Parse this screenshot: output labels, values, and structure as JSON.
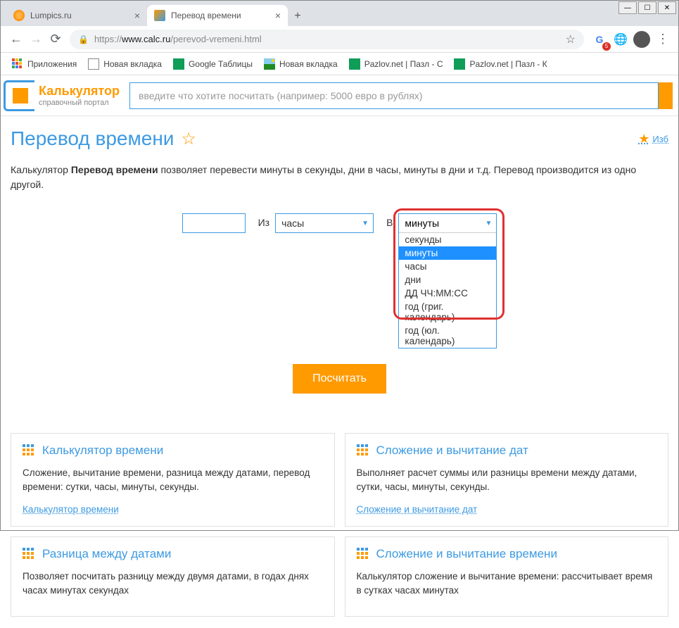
{
  "window": {
    "min": "—",
    "max": "☐",
    "close": "✕"
  },
  "tabs": [
    {
      "title": "Lumpics.ru",
      "favicon": "orange"
    },
    {
      "title": "Перевод времени",
      "favicon": "calc",
      "active": true
    }
  ],
  "address": {
    "url_proto": "https://",
    "url_host": "www.calc.ru",
    "url_path": "/perevod-vremeni.html",
    "gt_badge": "5"
  },
  "bookmarks": [
    {
      "label": "Приложения",
      "icon": "apps"
    },
    {
      "label": "Новая вкладка",
      "icon": "doc"
    },
    {
      "label": "Google Таблицы",
      "icon": "sheets"
    },
    {
      "label": "Новая вкладка",
      "icon": "img"
    },
    {
      "label": "Pazlov.net | Пазл - С",
      "icon": "puzzle"
    },
    {
      "label": "Pazlov.net | Пазл - К",
      "icon": "puzzle"
    }
  ],
  "site": {
    "brand": "Калькулятор",
    "subtitle": "справочный портал",
    "search_placeholder": "введите что хотите посчитать (например: 5000 евро в рублях)"
  },
  "page": {
    "title": "Перевод времени",
    "fav_link": "Изб",
    "desc_prefix": "Калькулятор ",
    "desc_bold": "Перевод времени",
    "desc_suffix": " позволяет перевести минуты в секунды, дни в часы, минуты в дни и т.д. Перевод производится из одно другой."
  },
  "converter": {
    "from_label": "Из",
    "from_value": "часы",
    "to_label": "В",
    "to_value": "минуты",
    "options": [
      "секунды",
      "минуты",
      "часы",
      "дни",
      "ДД ЧЧ:ММ:СС",
      "год (григ. календарь)",
      "год (юл. календарь)"
    ],
    "highlighted_index": 1,
    "button": "Посчитать"
  },
  "cards": {
    "left": [
      {
        "title": "Калькулятор времени",
        "desc": "Сложение, вычитание времени, разница между датами, перевод времени: сутки, часы, минуты, секунды.",
        "link": "Калькулятор времени"
      },
      {
        "title": "Разница между датами",
        "desc": "Позволяет посчитать разницу между двумя датами, в годах днях часах минутах секундах",
        "link": ""
      }
    ],
    "right": [
      {
        "title": "Сложение и вычитание дат",
        "desc": "Выполняет расчет суммы или разницы времени между датами, сутки, часы, минуты, секунды.",
        "link": "Сложение и вычитание дат"
      },
      {
        "title": "Сложение и вычитание времени",
        "desc": "Калькулятор сложение и вычитание времени: рассчитывает время в сутках часах минутах",
        "link": ""
      }
    ]
  }
}
